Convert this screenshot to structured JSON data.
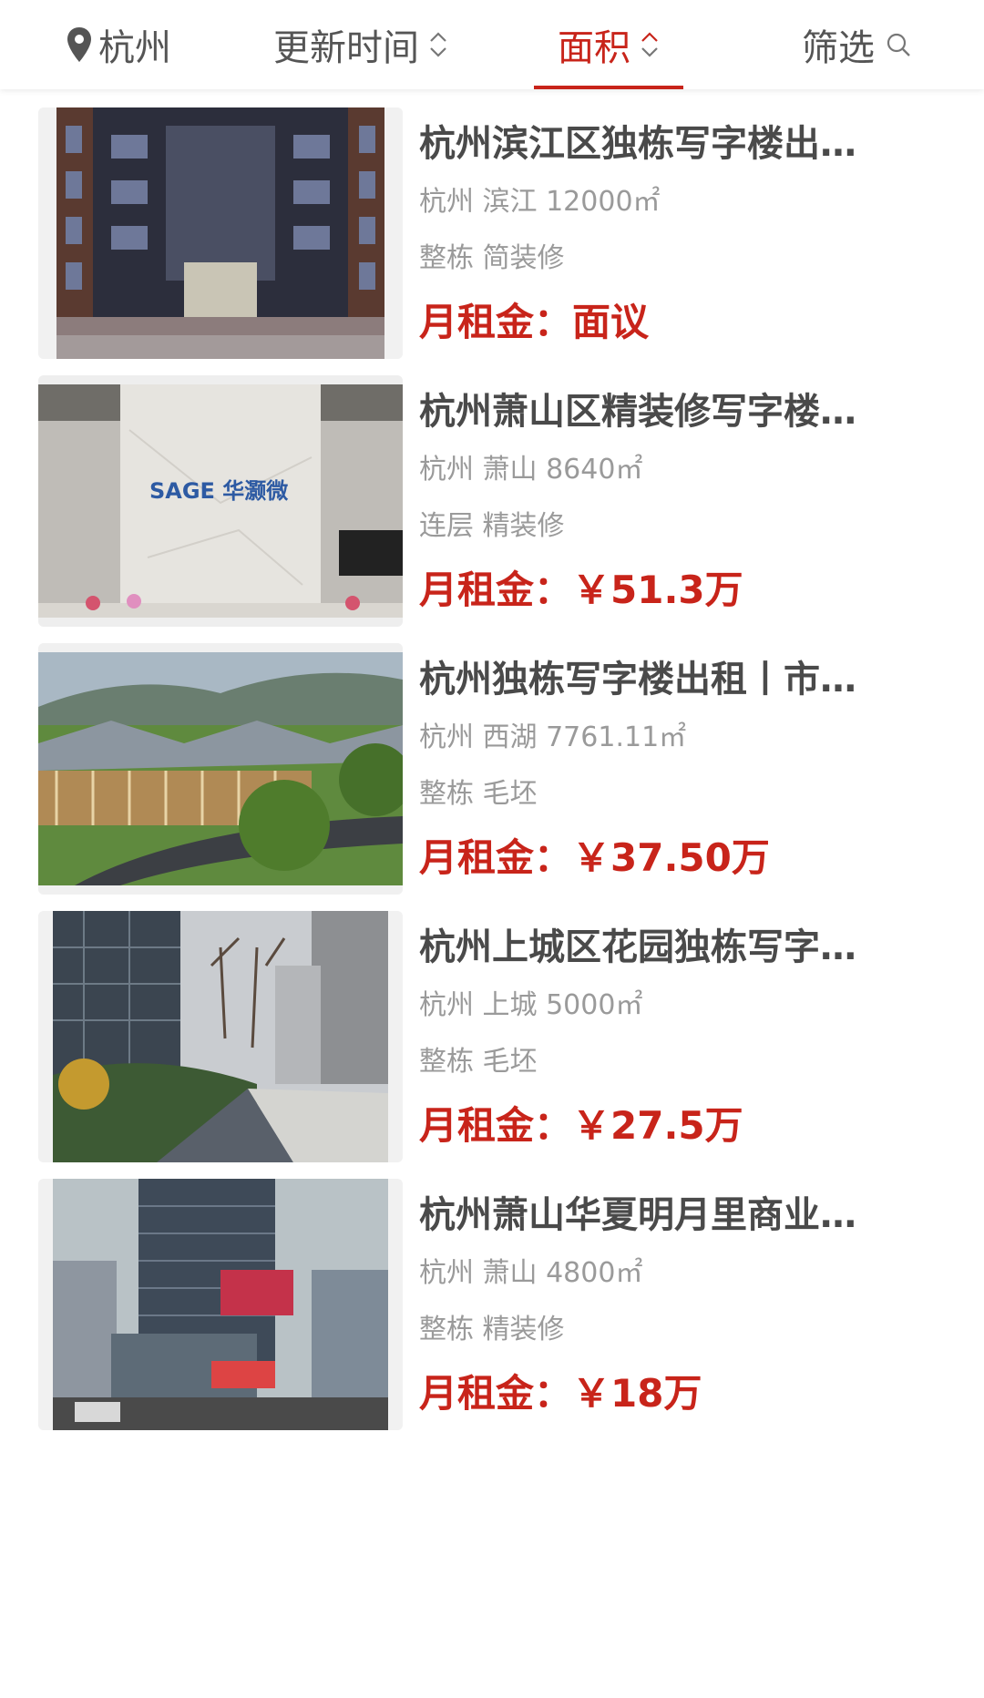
{
  "filter_bar": {
    "city": "杭州",
    "update_time": "更新时间",
    "area": "面积",
    "filter": "筛选",
    "accent_color": "#c8241a"
  },
  "listings": [
    {
      "title": "杭州滨江区独栋写字楼出…",
      "city": "杭州",
      "district": "滨江",
      "area": "12000㎡",
      "tags": "整栋 简装修",
      "price_label": "月租金：",
      "price": "面议"
    },
    {
      "title": "杭州萧山区精装修写字楼…",
      "city": "杭州",
      "district": "萧山",
      "area": "8640㎡",
      "tags": "连层 精装修",
      "price_label": "月租金：",
      "price": "￥51.3万",
      "image_text": "SAGE 华灏微"
    },
    {
      "title": "杭州独栋写字楼出租丨市…",
      "city": "杭州",
      "district": "西湖",
      "area": "7761.11㎡",
      "tags": "整栋 毛坯",
      "price_label": "月租金：",
      "price": "￥37.50万"
    },
    {
      "title": "杭州上城区花园独栋写字…",
      "city": "杭州",
      "district": "上城",
      "area": "5000㎡",
      "tags": "整栋 毛坯",
      "price_label": "月租金：",
      "price": "￥27.5万"
    },
    {
      "title": "杭州萧山华夏明月里商业…",
      "city": "杭州",
      "district": "萧山",
      "area": "4800㎡",
      "tags": "整栋 精装修",
      "price_label": "月租金：",
      "price": "￥18万"
    }
  ]
}
